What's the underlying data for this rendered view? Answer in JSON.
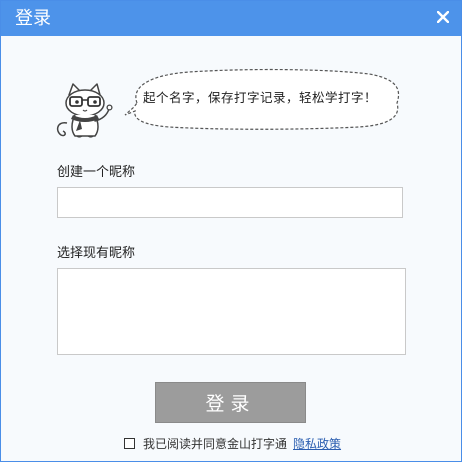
{
  "window": {
    "title": "登录",
    "close_icon": "close-icon",
    "accent_color": "#4d93ea"
  },
  "intro": {
    "mascot_icon": "cat-mascot-icon",
    "bubble_text": "起个名字，保存打字记录，轻松学打字！"
  },
  "form": {
    "create_label": "创建一个昵称",
    "create_value": "",
    "create_placeholder": "",
    "existing_label": "选择现有昵称",
    "existing_items": [],
    "login_label": "登录"
  },
  "agreement": {
    "checked": false,
    "text": "我已阅读并同意金山打字通",
    "link_text": "隐私政策"
  }
}
